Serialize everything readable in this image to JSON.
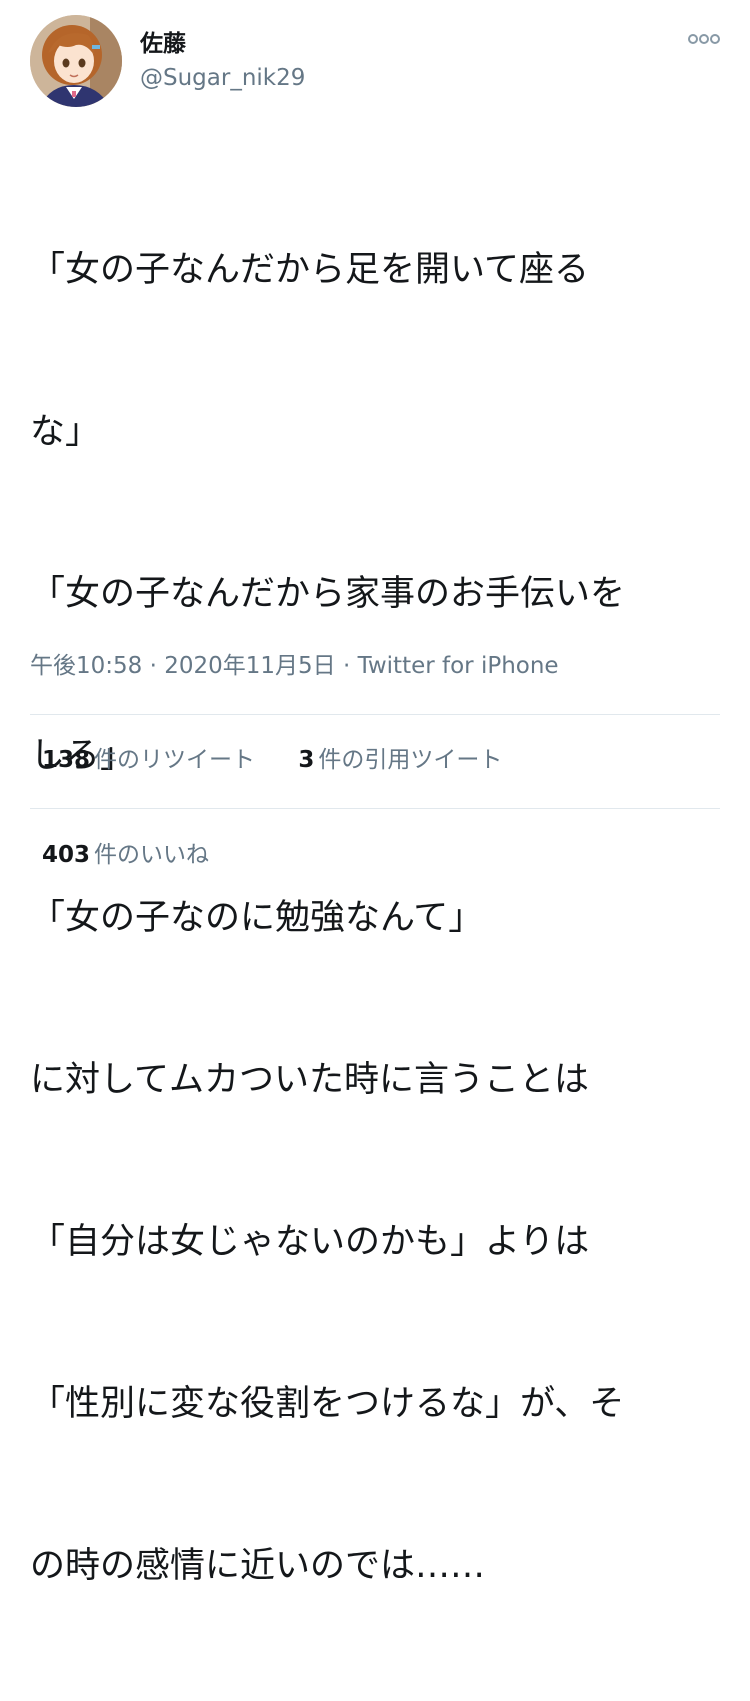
{
  "user": {
    "name": "佐藤",
    "handle": "@Sugar_nik29"
  },
  "tweet": {
    "lines": [
      "「女の子なんだから足を開いて座る",
      "な」",
      "「女の子なんだから家事のお手伝いを",
      "しろ」",
      "「女の子なのに勉強なんて」",
      "に対してムカついた時に言うことは",
      "「自分は女じゃないのかも」よりは",
      "「性別に変な役割をつけるな」が、そ",
      "の時の感情に近いのでは……"
    ],
    "time": "午後10:58",
    "separator": "·",
    "date": "2020年11月5日",
    "source": "Twitter for iPhone"
  },
  "stats": {
    "retweets": {
      "count": "138",
      "label": "件のリツイート"
    },
    "quotes": {
      "count": "3",
      "label": "件の引用ツイート"
    },
    "likes": {
      "count": "403",
      "label": "件のいいね"
    }
  },
  "icons": {
    "more": "more-horizontal-icon",
    "avatar": "profile-avatar"
  },
  "colors": {
    "text_primary": "#14171a",
    "text_secondary": "#657786",
    "divider": "#e1e8ed"
  }
}
